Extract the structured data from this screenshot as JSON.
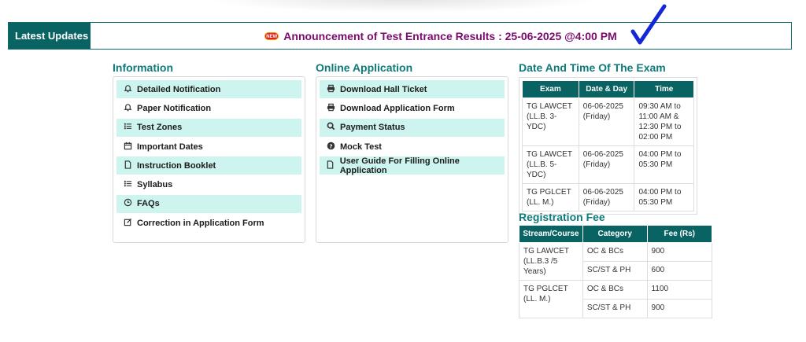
{
  "updates": {
    "label": "Latest Updates",
    "badge": "NEW",
    "announcement": "Announcement of Test Entrance Results : 25-06-2025 @4:00 PM"
  },
  "information": {
    "title": "Information",
    "items": [
      {
        "label": "Detailed Notification",
        "icon": "bell-icon"
      },
      {
        "label": "Paper Notification",
        "icon": "bell-icon"
      },
      {
        "label": "Test Zones",
        "icon": "list-icon"
      },
      {
        "label": "Important Dates",
        "icon": "calendar-icon"
      },
      {
        "label": "Instruction Booklet",
        "icon": "file-icon"
      },
      {
        "label": "Syllabus",
        "icon": "list-icon"
      },
      {
        "label": "FAQs",
        "icon": "clock-icon"
      },
      {
        "label": "Correction in Application Form",
        "icon": "edit-icon"
      }
    ]
  },
  "online": {
    "title": "Online Application",
    "items": [
      {
        "label": "Download Hall Ticket",
        "icon": "print-icon"
      },
      {
        "label": "Download Application Form",
        "icon": "print-icon"
      },
      {
        "label": "Payment Status",
        "icon": "search-icon"
      },
      {
        "label": "Mock Test",
        "icon": "question-icon"
      },
      {
        "label": "User Guide For Filling Online Application",
        "icon": "file-icon"
      }
    ]
  },
  "exam_schedule": {
    "title": "Date And Time Of The Exam",
    "headers": [
      "Exam",
      "Date & Day",
      "Time"
    ],
    "rows": [
      [
        "TG LAWCET (LL.B. 3-YDC)",
        "06-06-2025 (Friday)",
        "09:30 AM to 11:00 AM & 12:30 PM to 02:00 PM"
      ],
      [
        "TG LAWCET (LL.B. 5-YDC)",
        "06-06-2025 (Friday)",
        "04:00 PM to 05:30 PM"
      ],
      [
        "TG PGLCET (LL. M.)",
        "06-06-2025 (Friday)",
        "04:00 PM to 05:30 PM"
      ]
    ]
  },
  "registration_fee": {
    "title": "Registration Fee",
    "headers": [
      "Stream/Course",
      "Category",
      "Fee (Rs)"
    ],
    "groups": [
      {
        "course": "TG LAWCET (LL.B.3 /5 Years)",
        "rows": [
          [
            "OC & BCs",
            "900"
          ],
          [
            "SC/ST & PH",
            "600"
          ]
        ]
      },
      {
        "course": "TG PGLCET (LL. M.)",
        "rows": [
          [
            "OC & BCs",
            "1100"
          ],
          [
            "SC/ST & PH",
            "900"
          ]
        ]
      }
    ]
  },
  "colors": {
    "accent": "#0a6363",
    "title": "#0f7a7a",
    "highlight_row": "#cdf4ee",
    "announcement": "#7a0a6e",
    "check": "#1428d8"
  }
}
